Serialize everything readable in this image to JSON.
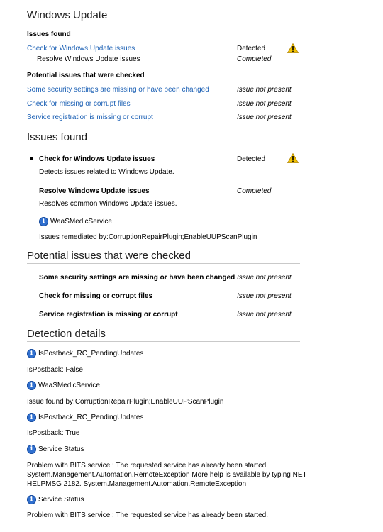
{
  "section1": {
    "title": "Windows Update",
    "issues_found_label": "Issues found",
    "issues": [
      {
        "name": "Check for Windows Update issues",
        "status": "Detected"
      },
      {
        "name": "Resolve Windows Update issues",
        "status": "Completed"
      }
    ],
    "potential_label": "Potential issues that were checked",
    "potential": [
      {
        "name": "Some security settings are missing or have been changed",
        "status": "Issue not present"
      },
      {
        "name": "Check for missing or corrupt files",
        "status": "Issue not present"
      },
      {
        "name": "Service registration is missing or corrupt",
        "status": "Issue not present"
      }
    ]
  },
  "section2": {
    "title": "Issues found",
    "issue1": {
      "name": "Check for Windows Update issues",
      "status": "Detected",
      "desc": "Detects issues related to Windows Update."
    },
    "issue2": {
      "name": "Resolve Windows Update issues",
      "status": "Completed",
      "desc": "Resolves common Windows Update issues."
    },
    "service_name": "WaaSMedicService",
    "remediated": "Issues remediated by:CorruptionRepairPlugin;EnableUUPScanPlugin"
  },
  "section3": {
    "title": "Potential issues that were checked",
    "items": [
      {
        "name": "Some security settings are missing or have been changed",
        "status": "Issue not present"
      },
      {
        "name": "Check for missing or corrupt files",
        "status": "Issue not present"
      },
      {
        "name": "Service registration is missing or corrupt",
        "status": "Issue not present"
      }
    ]
  },
  "section4": {
    "title": "Detection details",
    "details": [
      {
        "name": "IsPostback_RC_PendingUpdates",
        "text": "IsPostback: False"
      },
      {
        "name": "WaaSMedicService",
        "text": "Issue found by:CorruptionRepairPlugin;EnableUUPScanPlugin"
      },
      {
        "name": "IsPostback_RC_PendingUpdates",
        "text": "IsPostback: True"
      },
      {
        "name": "Service Status",
        "lines": [
          "Problem with BITS service : The requested service has already been started.",
          "System.Management.Automation.RemoteException More help is available by typing NET",
          "HELPMSG 2182. System.Management.Automation.RemoteException"
        ]
      },
      {
        "name": "Service Status",
        "text": "Problem with BITS service : The requested service has already been started."
      }
    ]
  },
  "icons": {
    "warning": "warning-triangle-icon",
    "info": "info-icon"
  },
  "colors": {
    "link": "#1a5fb4",
    "warning": "#f2c200",
    "info": "#2f6fcf"
  }
}
